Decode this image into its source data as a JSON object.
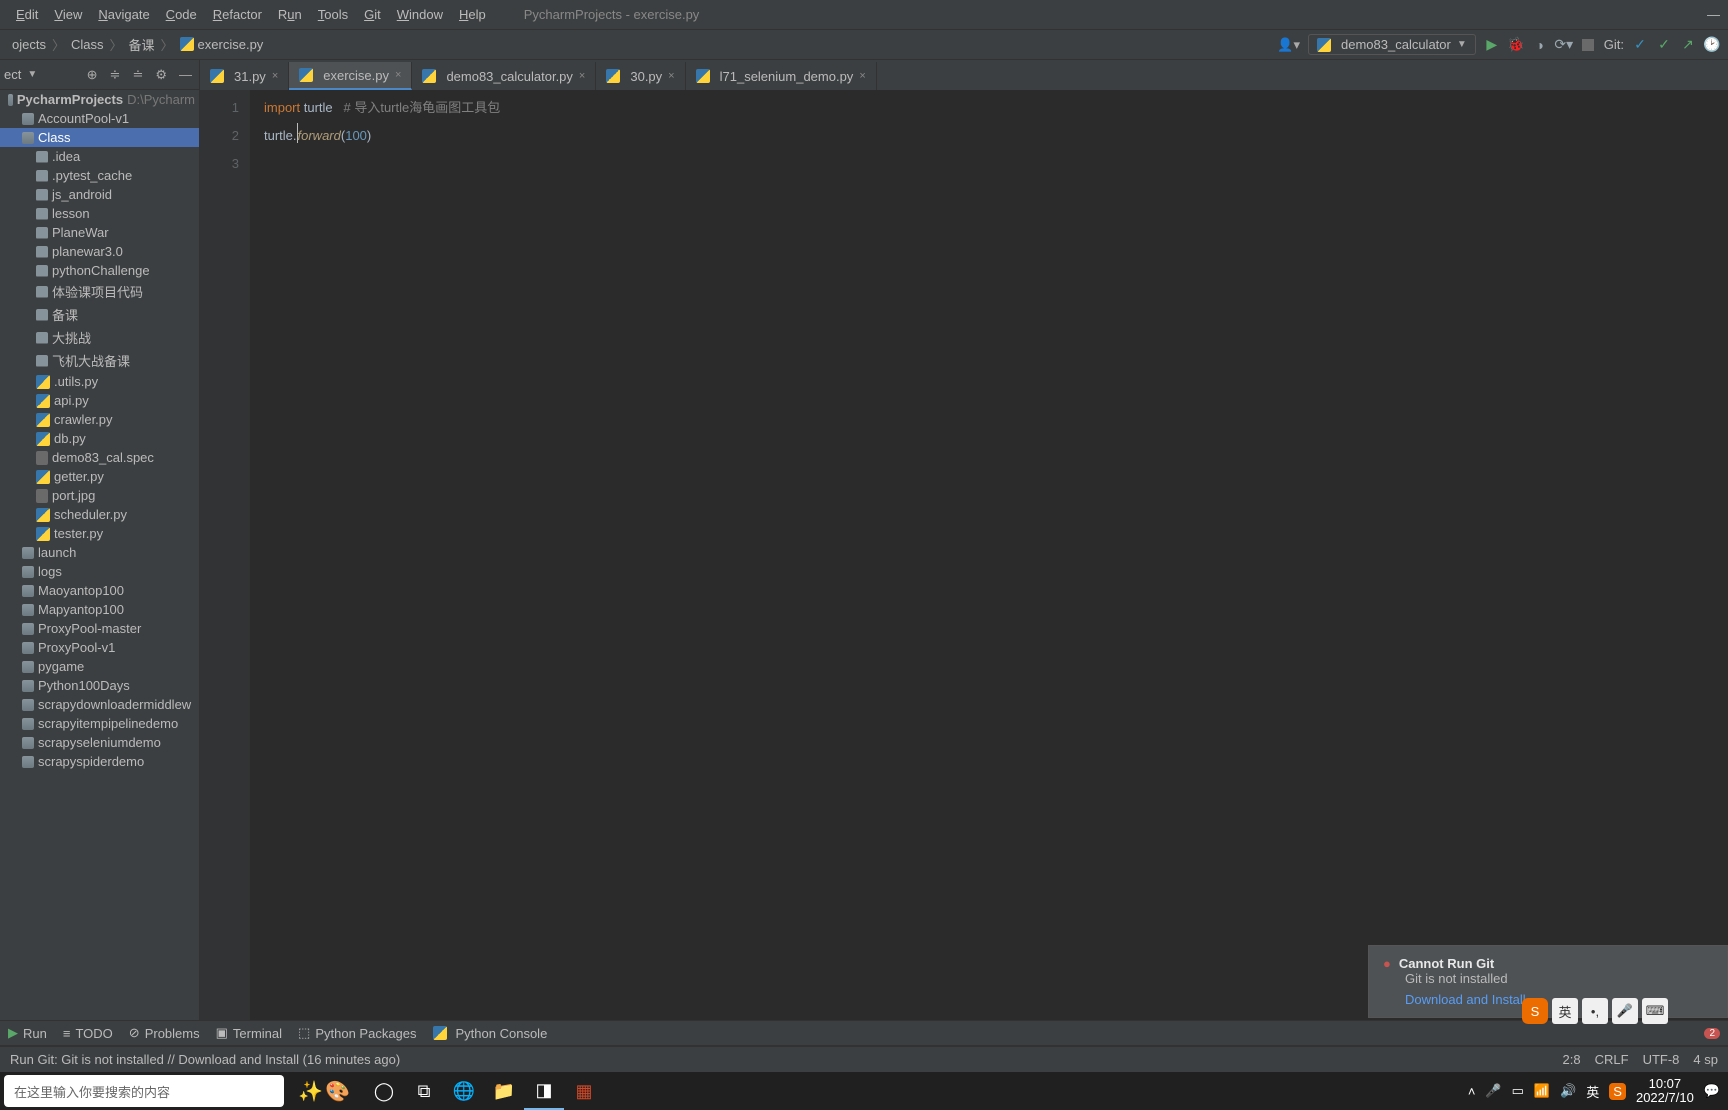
{
  "menu": {
    "edit": "Edit",
    "view": "View",
    "navigate": "Navigate",
    "code": "Code",
    "refactor": "Refactor",
    "run": "Run",
    "tools": "Tools",
    "git": "Git",
    "window": "Window",
    "help": "Help"
  },
  "window_title": "PycharmProjects - exercise.py",
  "breadcrumb": [
    "ojects",
    "Class",
    "备课",
    "exercise.py"
  ],
  "run_config": "demo83_calculator",
  "git_label": "Git:",
  "sidebar": {
    "project_label": "ect",
    "items": [
      {
        "t": "PycharmProjects",
        "hint": "D:\\Pycharm",
        "type": "proj",
        "ind": 0
      },
      {
        "t": "AccountPool-v1",
        "type": "mod",
        "ind": 1
      },
      {
        "t": "Class",
        "type": "mod",
        "ind": 1,
        "sel": true
      },
      {
        "t": ".idea",
        "type": "fold",
        "ind": 2
      },
      {
        "t": ".pytest_cache",
        "type": "fold",
        "ind": 2
      },
      {
        "t": "js_android",
        "type": "fold",
        "ind": 2
      },
      {
        "t": "lesson",
        "type": "fold",
        "ind": 2
      },
      {
        "t": "PlaneWar",
        "type": "fold",
        "ind": 2
      },
      {
        "t": "planewar3.0",
        "type": "fold",
        "ind": 2
      },
      {
        "t": "pythonChallenge",
        "type": "fold",
        "ind": 2
      },
      {
        "t": "体验课项目代码",
        "type": "fold",
        "ind": 2
      },
      {
        "t": "备课",
        "type": "fold",
        "ind": 2
      },
      {
        "t": "大挑战",
        "type": "fold",
        "ind": 2
      },
      {
        "t": "飞机大战备课",
        "type": "fold",
        "ind": 2
      },
      {
        "t": ".utils.py",
        "type": "py",
        "ind": 2
      },
      {
        "t": "api.py",
        "type": "py",
        "ind": 2
      },
      {
        "t": "crawler.py",
        "type": "py",
        "ind": 2
      },
      {
        "t": "db.py",
        "type": "py",
        "ind": 2
      },
      {
        "t": "demo83_cal.spec",
        "type": "txt",
        "ind": 2
      },
      {
        "t": "getter.py",
        "type": "py",
        "ind": 2
      },
      {
        "t": "port.jpg",
        "type": "txt",
        "ind": 2
      },
      {
        "t": "scheduler.py",
        "type": "py",
        "ind": 2
      },
      {
        "t": "tester.py",
        "type": "py",
        "ind": 2
      },
      {
        "t": "launch",
        "type": "mod",
        "ind": 1
      },
      {
        "t": "logs",
        "type": "mod",
        "ind": 1
      },
      {
        "t": "Maoyantop100",
        "type": "mod",
        "ind": 1
      },
      {
        "t": "Mapyantop100",
        "type": "mod",
        "ind": 1
      },
      {
        "t": "ProxyPool-master",
        "type": "mod",
        "ind": 1
      },
      {
        "t": "ProxyPool-v1",
        "type": "mod",
        "ind": 1
      },
      {
        "t": "pygame",
        "type": "mod",
        "ind": 1
      },
      {
        "t": "Python100Days",
        "type": "mod",
        "ind": 1
      },
      {
        "t": "scrapydownloadermiddlew",
        "type": "mod",
        "ind": 1
      },
      {
        "t": "scrapyitempipelinedemo",
        "type": "mod",
        "ind": 1
      },
      {
        "t": "scrapyseleniumdemo",
        "type": "mod",
        "ind": 1
      },
      {
        "t": "scrapyspiderdemo",
        "type": "mod",
        "ind": 1
      }
    ]
  },
  "tabs": [
    {
      "name": "31.py"
    },
    {
      "name": "exercise.py",
      "act": true
    },
    {
      "name": "demo83_calculator.py"
    },
    {
      "name": "30.py"
    },
    {
      "name": "l71_selenium_demo.py"
    }
  ],
  "code": {
    "l1": {
      "kw": "import",
      "mod": "turtle",
      "cm": "#  导入turtle海龟画图工具包"
    },
    "l2": {
      "obj": "turtle.",
      "fn": "forward",
      "open": "(",
      "num": "100",
      "close": ")"
    },
    "lines": [
      "1",
      "2",
      "3"
    ]
  },
  "notif": {
    "title": "Cannot Run Git",
    "body": "Git is not installed",
    "link": "Download and Install"
  },
  "bottom": {
    "run": "Run",
    "todo": "TODO",
    "problems": "Problems",
    "terminal": "Terminal",
    "pkg": "Python Packages",
    "console": "Python Console"
  },
  "status": {
    "msg": "Run Git: Git is not installed // Download and Install (16 minutes ago)",
    "pos": "2:8",
    "eol": "CRLF",
    "enc": "UTF-8",
    "indent": "4 sp"
  },
  "taskbar": {
    "search": "在这里输入你要搜索的内容",
    "time": "10:07",
    "date": "2022/7/10"
  }
}
